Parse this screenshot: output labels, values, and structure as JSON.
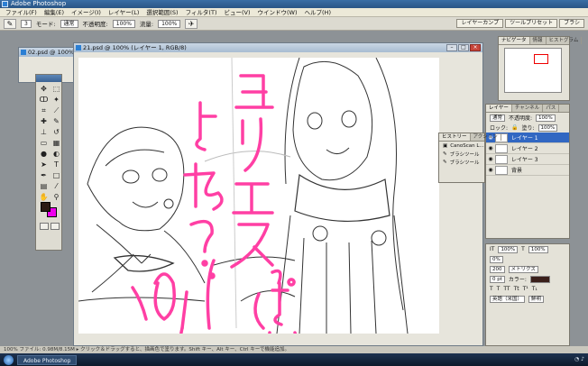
{
  "app": {
    "title": "Adobe Photoshop"
  },
  "menu": [
    "ファイル(F)",
    "編集(E)",
    "イメージ(I)",
    "レイヤー(L)",
    "選択範囲(S)",
    "フィルタ(T)",
    "ビュー(V)",
    "ウインドウ(W)",
    "ヘルプ(H)"
  ],
  "options": {
    "brush_size": "3",
    "mode_label": "モード:",
    "mode_value": "通常",
    "opacity_label": "不透明度:",
    "opacity_value": "100%",
    "flow_label": "流量:",
    "flow_value": "100%"
  },
  "wells": [
    "レイヤーカンプ",
    "ツールプリセット",
    "ブラシ"
  ],
  "docs": {
    "back": {
      "title": "02.psd @ 100% (レイヤ..."
    },
    "front": {
      "title": "21.psd @ 100% (レイヤー 1, RGB/8)"
    }
  },
  "navigator": {
    "tabs": [
      "ナビゲータ",
      "情報",
      "ヒストグラム"
    ]
  },
  "layers": {
    "tabs": [
      "レイヤー",
      "チャンネル",
      "パス"
    ],
    "blend": "通常",
    "opacity_label": "不透明度:",
    "opacity_value": "100%",
    "lock_label": "ロック:",
    "fill_label": "塗り:",
    "fill_value": "100%",
    "items": [
      {
        "name": "レイヤー 1",
        "selected": true
      },
      {
        "name": "レイヤー 2",
        "selected": false
      },
      {
        "name": "レイヤー 3",
        "selected": false
      },
      {
        "name": "背景",
        "selected": false
      }
    ]
  },
  "history": {
    "tabs": [
      "ヒストリー",
      "アクション"
    ],
    "items": [
      "CanoScan L...",
      "ブラシツール",
      "ブラシツール"
    ]
  },
  "character": {
    "row1": [
      "100%",
      "100%"
    ],
    "row2": [
      "0%"
    ],
    "row3": [
      "200",
      "メトリクス"
    ],
    "row4": [
      "0 pt",
      "カラー:"
    ],
    "lang": "英語（米国）",
    "aa": "鮮明"
  },
  "status": {
    "text": "100%     ファイル: 0.98M/8.15M   ▸   クリック＆ドラッグすると、描画色で塗ります。Shift キー、Alt キー、Ctrl キーで機能追加。"
  },
  "taskbar": {
    "item": "Adobe Photoshop"
  },
  "colors": {
    "foreground": "#2b1a14",
    "background": "#ee00ee",
    "annotation": "#ff3fa4"
  }
}
